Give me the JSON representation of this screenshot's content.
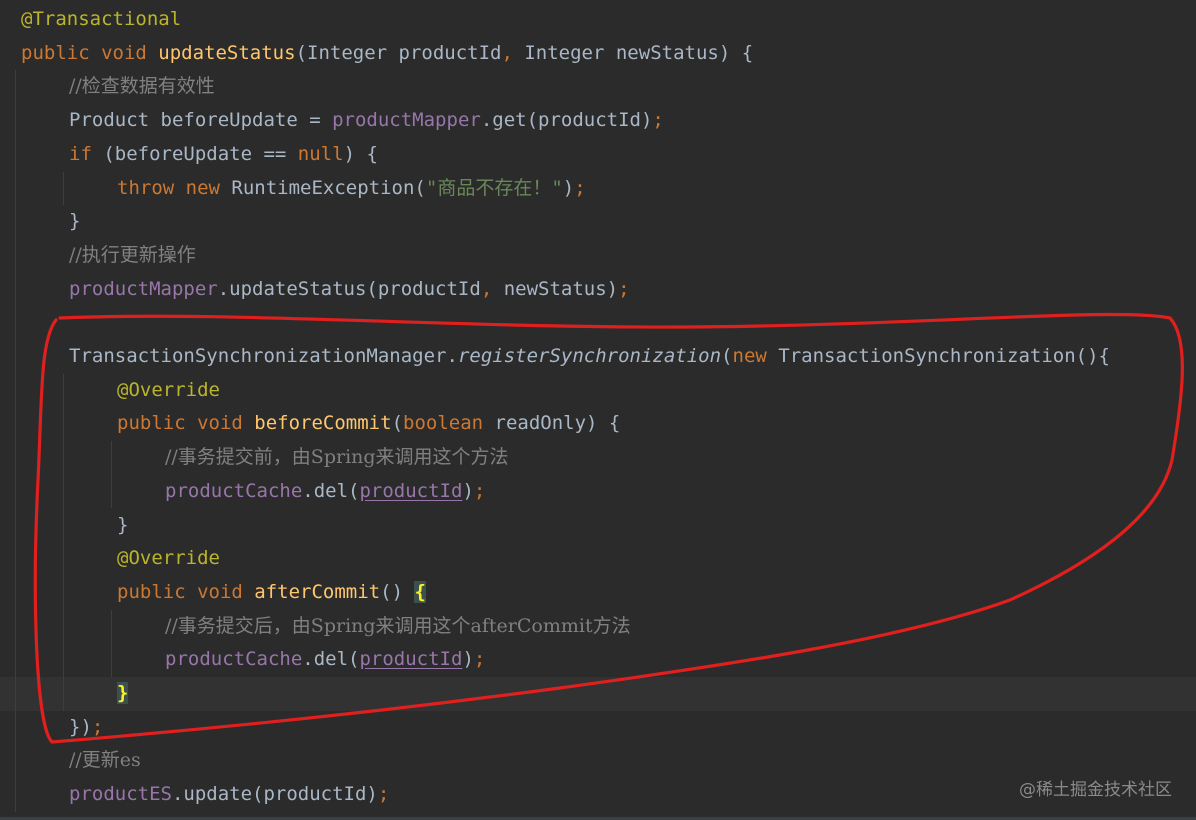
{
  "editor": {
    "lines": [
      {
        "indent": 0,
        "tokens": [
          {
            "t": "@Transactional",
            "c": "ann"
          }
        ]
      },
      {
        "indent": 0,
        "tokens": [
          {
            "t": "public ",
            "c": "kw"
          },
          {
            "t": "void ",
            "c": "kw"
          },
          {
            "t": "updateStatus",
            "c": "mth"
          },
          {
            "t": "(Integer productId",
            "c": "plain"
          },
          {
            "t": ", ",
            "c": "kw"
          },
          {
            "t": "Integer newStatus) {",
            "c": "plain"
          }
        ]
      },
      {
        "indent": 1,
        "tokens": [
          {
            "t": "//检查数据有效性",
            "c": "cmt"
          }
        ]
      },
      {
        "indent": 1,
        "tokens": [
          {
            "t": "Product beforeUpdate = ",
            "c": "plain"
          },
          {
            "t": "productMapper",
            "c": "fld"
          },
          {
            "t": ".get(productId)",
            "c": "plain"
          },
          {
            "t": ";",
            "c": "kw"
          }
        ]
      },
      {
        "indent": 1,
        "tokens": [
          {
            "t": "if ",
            "c": "kw"
          },
          {
            "t": "(beforeUpdate == ",
            "c": "plain"
          },
          {
            "t": "null",
            "c": "kw"
          },
          {
            "t": ") {",
            "c": "plain"
          }
        ]
      },
      {
        "indent": 2,
        "tokens": [
          {
            "t": "throw ",
            "c": "kw"
          },
          {
            "t": "new ",
            "c": "kw"
          },
          {
            "t": "RuntimeException(",
            "c": "plain"
          },
          {
            "t": "\"商品不存在！\"",
            "c": "str"
          },
          {
            "t": ")",
            "c": "plain"
          },
          {
            "t": ";",
            "c": "kw"
          }
        ]
      },
      {
        "indent": 1,
        "tokens": [
          {
            "t": "}",
            "c": "plain"
          }
        ]
      },
      {
        "indent": 1,
        "tokens": [
          {
            "t": "//执行更新操作",
            "c": "cmt"
          }
        ]
      },
      {
        "indent": 1,
        "tokens": [
          {
            "t": "productMapper",
            "c": "fld"
          },
          {
            "t": ".updateStatus(productId",
            "c": "plain"
          },
          {
            "t": ", ",
            "c": "kw"
          },
          {
            "t": "newStatus)",
            "c": "plain"
          },
          {
            "t": ";",
            "c": "kw"
          }
        ]
      },
      {
        "indent": 0,
        "tokens": []
      },
      {
        "indent": 1,
        "tokens": [
          {
            "t": "TransactionSynchronizationManager.",
            "c": "plain"
          },
          {
            "t": "registerSynchronization",
            "c": "plain",
            "italic": true
          },
          {
            "t": "(",
            "c": "plain"
          },
          {
            "t": "new ",
            "c": "kw"
          },
          {
            "t": "TransactionSynchronization(){",
            "c": "plain"
          }
        ]
      },
      {
        "indent": 2,
        "tokens": [
          {
            "t": "@Override",
            "c": "ann"
          }
        ]
      },
      {
        "indent": 2,
        "tokens": [
          {
            "t": "public ",
            "c": "kw"
          },
          {
            "t": "void ",
            "c": "kw"
          },
          {
            "t": "beforeCommit",
            "c": "mth"
          },
          {
            "t": "(",
            "c": "plain"
          },
          {
            "t": "boolean ",
            "c": "kw"
          },
          {
            "t": "readOnly) {",
            "c": "plain"
          }
        ]
      },
      {
        "indent": 3,
        "tokens": [
          {
            "t": "//事务提交前，由Spring来调用这个方法",
            "c": "cmt"
          }
        ]
      },
      {
        "indent": 3,
        "tokens": [
          {
            "t": "productCache",
            "c": "fld"
          },
          {
            "t": ".del(",
            "c": "plain"
          },
          {
            "t": "productId",
            "c": "fld",
            "underline": true
          },
          {
            "t": ")",
            "c": "plain"
          },
          {
            "t": ";",
            "c": "kw"
          }
        ]
      },
      {
        "indent": 2,
        "tokens": [
          {
            "t": "}",
            "c": "plain"
          }
        ]
      },
      {
        "indent": 2,
        "tokens": [
          {
            "t": "@Override",
            "c": "ann"
          }
        ]
      },
      {
        "indent": 2,
        "tokens": [
          {
            "t": "public ",
            "c": "kw"
          },
          {
            "t": "void ",
            "c": "kw"
          },
          {
            "t": "afterCommit",
            "c": "mth"
          },
          {
            "t": "() ",
            "c": "plain"
          },
          {
            "t": "{",
            "c": "brace-hl"
          }
        ]
      },
      {
        "indent": 3,
        "tokens": [
          {
            "t": "//事务提交后，由Spring来调用这个afterCommit方法",
            "c": "cmt"
          }
        ]
      },
      {
        "indent": 3,
        "tokens": [
          {
            "t": "productCache",
            "c": "fld"
          },
          {
            "t": ".del(",
            "c": "plain"
          },
          {
            "t": "productId",
            "c": "fld",
            "underline": true
          },
          {
            "t": ")",
            "c": "plain"
          },
          {
            "t": ";",
            "c": "kw"
          }
        ]
      },
      {
        "indent": 2,
        "current": true,
        "tokens": [
          {
            "t": "}",
            "c": "brace-hl"
          }
        ]
      },
      {
        "indent": 1,
        "tokens": [
          {
            "t": "})",
            "c": "plain"
          },
          {
            "t": ";",
            "c": "kw"
          }
        ]
      },
      {
        "indent": 1,
        "tokens": [
          {
            "t": "//更新es",
            "c": "cmt"
          }
        ]
      },
      {
        "indent": 1,
        "tokens": [
          {
            "t": "productES",
            "c": "fld"
          },
          {
            "t": ".update(productId)",
            "c": "plain"
          },
          {
            "t": ";",
            "c": "kw"
          }
        ]
      }
    ],
    "highlight_color": "#e0201e"
  },
  "watermark": "@稀土掘金技术社区"
}
